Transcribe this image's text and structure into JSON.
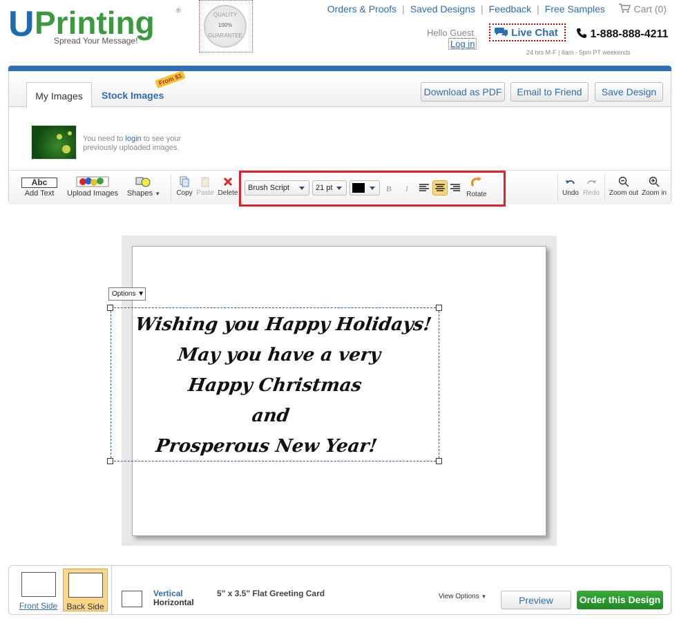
{
  "header": {
    "logo_u": "U",
    "logo_rest": "Printing",
    "logo_reg": "®",
    "tagline": "Spread Your Message!",
    "seal_lines": [
      "QUALITY",
      "100%",
      "GUARANTEE"
    ],
    "links": [
      "Orders & Proofs",
      "Saved Designs",
      "Feedback",
      "Free Samples"
    ],
    "cart": "Cart (0)",
    "hello": "Hello",
    "guest": "Guest",
    "login": "Log in",
    "live_chat": "Live Chat",
    "phone": "1-888-888-4211",
    "hours": "24 hrs M-F  |  8am - 5pm PT weekends"
  },
  "panel": {
    "tabs": [
      {
        "label": "My Images"
      },
      {
        "label": "Stock Images"
      }
    ],
    "badge": "From $1",
    "buttons": {
      "pdf": "Download as PDF",
      "email": "Email to Friend",
      "save": "Save Design"
    },
    "login_msg_pre": "You need to ",
    "login_msg_link": "login",
    "login_msg_post": " to see your",
    "login_msg_line2": "previously uploaded images."
  },
  "toolbar": {
    "add_text_icon": "Abc",
    "add_text": "Add Text",
    "upload_images": "Upload Images",
    "shapes": "Shapes",
    "copy": "Copy",
    "paste": "Paste",
    "delete": "Delete",
    "font": "Brush Script",
    "size": "21 pt",
    "bold": "B",
    "italic": "I",
    "rotate": "Rotate",
    "undo": "Undo",
    "redo": "Redo",
    "zoom_out": "Zoom out",
    "zoom_in": "Zoom in",
    "text_color": "#000000",
    "highlight_color": "#e0202a"
  },
  "canvas": {
    "options": "Options ▼",
    "lines": [
      "Wishing you Happy Holidays!",
      "May you have a very",
      "Happy Christmas",
      "and",
      "Prosperous New Year!"
    ]
  },
  "bottom": {
    "front": "Front Side",
    "back": "Back Side",
    "vertical": "Vertical",
    "horizontal": "Horizontal",
    "product": "5\" x 3.5\" Flat Greeting Card",
    "view_options": "View Options",
    "preview": "Preview",
    "order": "Order this Design"
  }
}
